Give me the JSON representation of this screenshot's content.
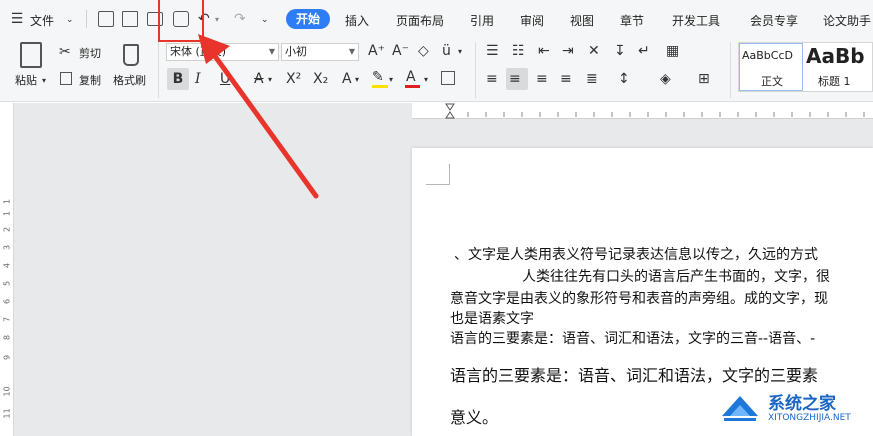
{
  "menu": {
    "hamburger_label": "文件",
    "tabs": [
      "开始",
      "插入",
      "页面布局",
      "引用",
      "审阅",
      "视图",
      "章节",
      "开发工具",
      "会员专享",
      "论文助手"
    ]
  },
  "ribbon": {
    "paste_label": "粘贴",
    "cut_label": "剪切",
    "copy_label": "复制",
    "format_painter_label": "格式刷",
    "font_name": "宋体 (正文)",
    "font_size": "小初",
    "styles": [
      {
        "preview": "AaBbCcD",
        "name": "正文"
      },
      {
        "preview": "AaBb",
        "name": "标题 1"
      }
    ]
  },
  "ruler": {
    "vertical_numbers": [
      "1",
      "1",
      "2",
      "3",
      "4",
      "5",
      "6",
      "7",
      "8",
      "9",
      "10",
      "11"
    ]
  },
  "document": {
    "lines": [
      "、文字是人类用表义符号记录表达信息以传之，久远的方式",
      "人类往往先有口头的语言后产生书面的，文字，很",
      "意音文字是由表义的象形符号和表音的声旁组。成的文字，现",
      "也是语素文字",
      "语言的三要素是：语音、词汇和语法，文字的三音--语音、-"
    ],
    "large_lines": [
      "语言的三要素是：语音、词汇和语法，文字的三要素",
      "意义。"
    ]
  },
  "watermark": {
    "title": "系统之家",
    "url": "XITONGZHIJIA.NET"
  },
  "colors": {
    "accent": "#2f7df6",
    "arrow": "#e8342b",
    "highlight_yellow": "#ffe100",
    "font_red": "#e02020"
  }
}
